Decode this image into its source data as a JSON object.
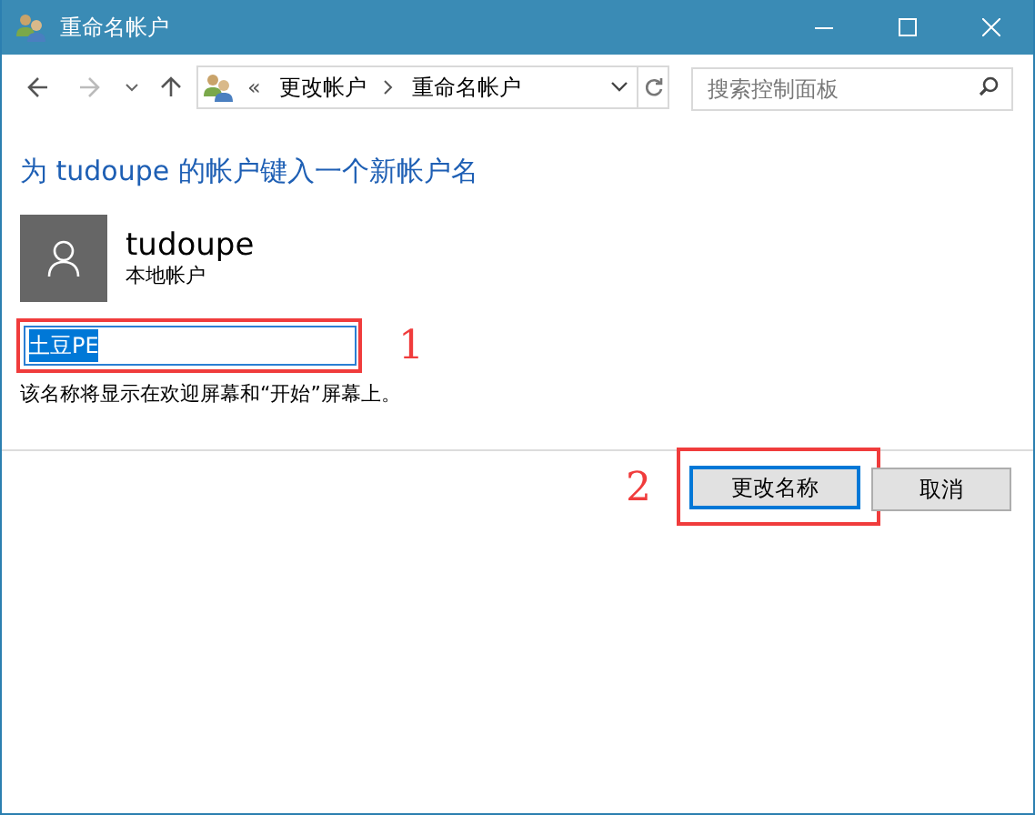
{
  "window": {
    "title": "重命名帐户"
  },
  "address_bar": {
    "overflow": "«",
    "crumbs": [
      "更改帐户",
      "重命名帐户"
    ]
  },
  "search": {
    "placeholder": "搜索控制面板"
  },
  "heading": "为 tudoupe 的帐户键入一个新帐户名",
  "account": {
    "name": "tudoupe",
    "type": "本地帐户"
  },
  "name_field": {
    "value": "土豆PE",
    "text_selected": true
  },
  "hint": "该名称将显示在欢迎屏幕和“开始”屏幕上。",
  "buttons": [
    {
      "label": "更改名称",
      "focused": true
    },
    {
      "label": "取消",
      "focused": false
    }
  ],
  "annotations": [
    "1",
    "2"
  ]
}
